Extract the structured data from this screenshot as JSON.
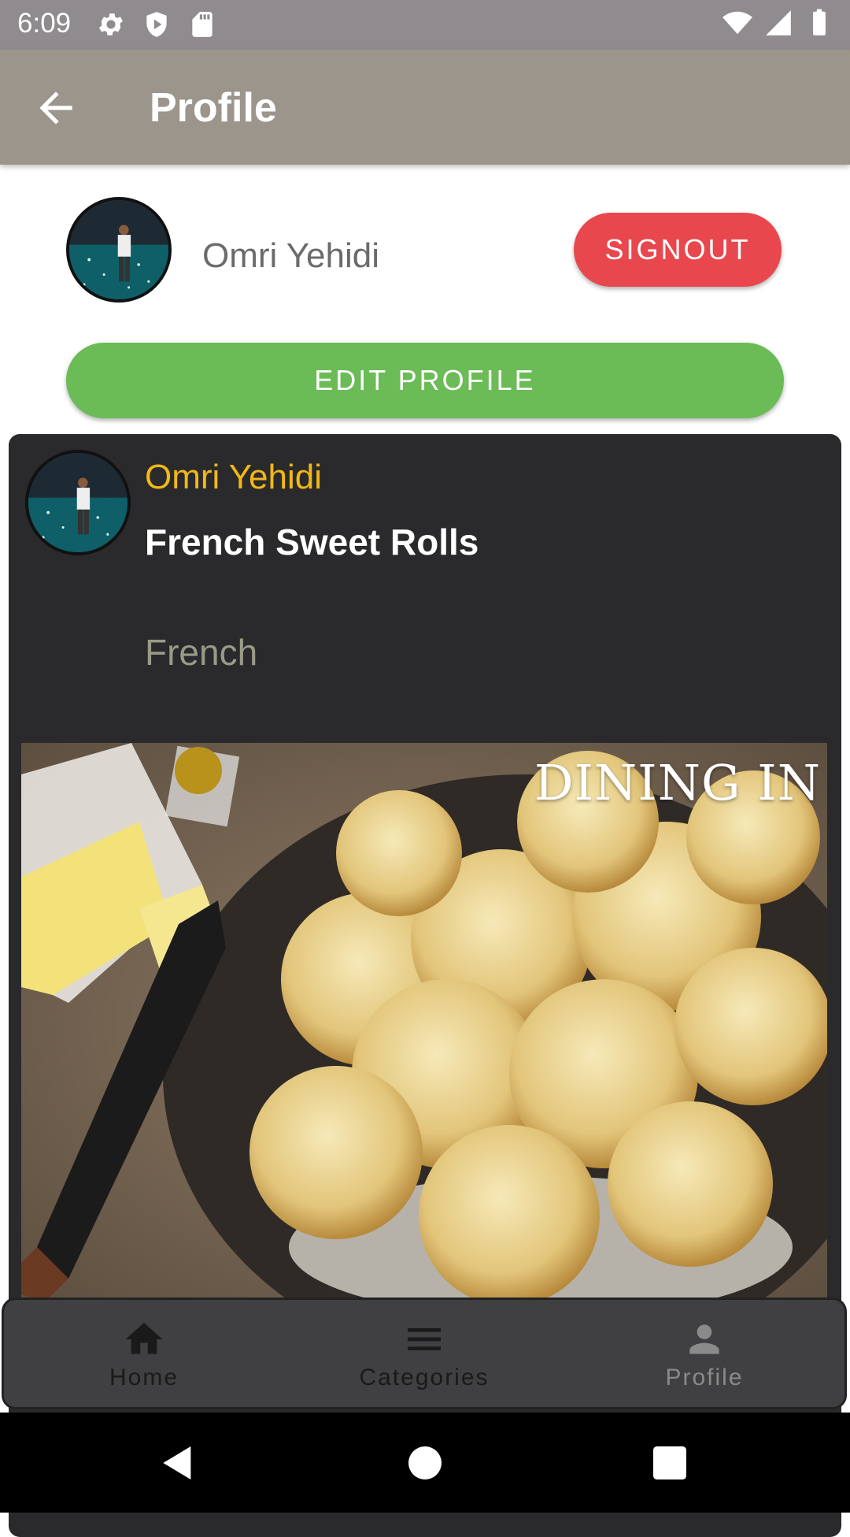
{
  "status_bar": {
    "time": "6:09"
  },
  "app_bar": {
    "title": "Profile"
  },
  "profile": {
    "name": "Omri Yehidi",
    "signout_label": "SIGNOUT",
    "edit_label": "EDIT PROFILE"
  },
  "recipe": {
    "author": "Omri Yehidi",
    "title": "French Sweet Rolls",
    "cuisine": "French",
    "image_text": "DINING IN"
  },
  "bottom_nav": {
    "items": [
      {
        "label": "Home",
        "icon": "home-icon"
      },
      {
        "label": "Categories",
        "icon": "menu-icon"
      },
      {
        "label": "Profile",
        "icon": "person-icon"
      }
    ]
  },
  "colors": {
    "status_bar": "#8f8b8e",
    "app_bar": "#9c958c",
    "signout": "#e8474d",
    "edit_profile": "#6bbb56",
    "card_bg": "#2a2a2c",
    "author_accent": "#f2b818",
    "nav_bg": "#403f41"
  }
}
